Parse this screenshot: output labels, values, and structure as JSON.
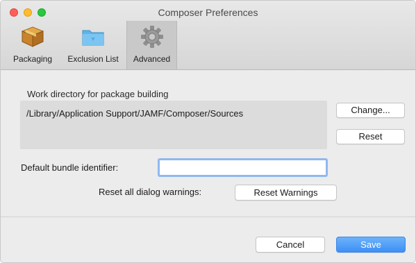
{
  "window": {
    "title": "Composer Preferences"
  },
  "tabs": [
    {
      "label": "Packaging",
      "icon": "package-box-icon",
      "selected": false
    },
    {
      "label": "Exclusion List",
      "icon": "folder-icon",
      "selected": false
    },
    {
      "label": "Advanced",
      "icon": "gear-icon",
      "selected": true
    }
  ],
  "work_directory": {
    "label": "Work directory for package building",
    "path": "/Library/Application Support/JAMF/Composer/Sources",
    "change_label": "Change...",
    "reset_label": "Reset"
  },
  "bundle_identifier": {
    "label": "Default bundle identifier:",
    "value": "",
    "placeholder": ""
  },
  "dialog_warnings": {
    "label": "Reset all dialog warnings:",
    "button_label": "Reset Warnings"
  },
  "footer": {
    "cancel_label": "Cancel",
    "save_label": "Save"
  },
  "colors": {
    "accent": "#3d8ff5",
    "close": "#ff5f57",
    "minimize": "#febc2e",
    "zoom": "#28c840"
  }
}
